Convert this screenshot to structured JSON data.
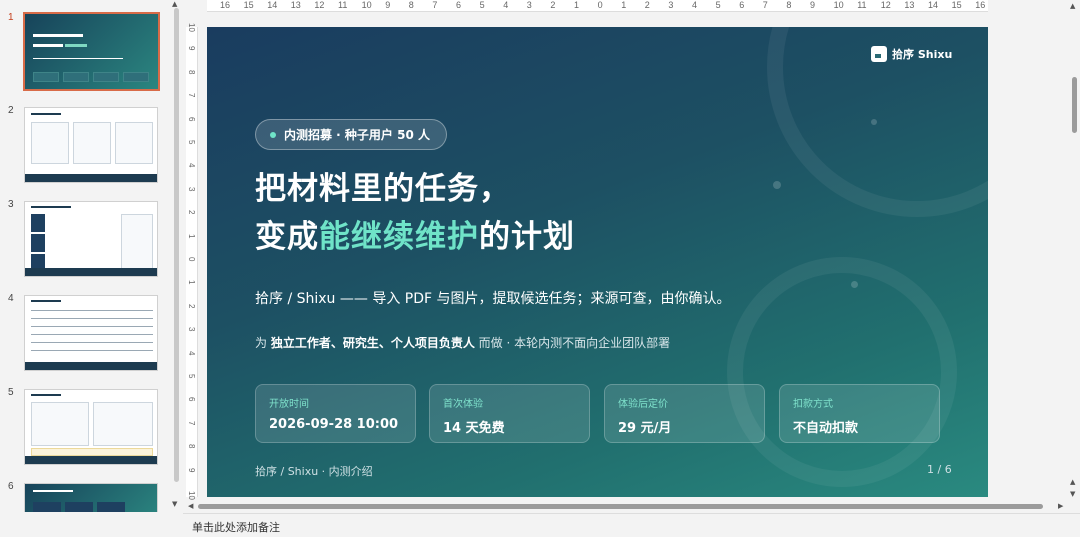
{
  "thumbnails": {
    "numbers": [
      "1",
      "2",
      "3",
      "4",
      "5",
      "6"
    ],
    "active_index": 1
  },
  "ruler": {
    "horizontal": [
      "16",
      "15",
      "14",
      "13",
      "12",
      "11",
      "10",
      "9",
      "8",
      "7",
      "6",
      "5",
      "4",
      "3",
      "2",
      "1",
      "0",
      "1",
      "2",
      "3",
      "4",
      "5",
      "6",
      "7",
      "8",
      "9",
      "10",
      "11",
      "12",
      "13",
      "14",
      "15",
      "16"
    ],
    "vertical": [
      "10",
      "9",
      "8",
      "7",
      "6",
      "5",
      "4",
      "3",
      "2",
      "1",
      "0",
      "1",
      "2",
      "3",
      "4",
      "5",
      "6",
      "7",
      "8",
      "9",
      "10"
    ]
  },
  "slide": {
    "brand": "拾序 Shixu",
    "pill": "内测招募 · 种子用户 50 人",
    "title_line1": "把材料里的任务，",
    "title_line2_prefix": "变成",
    "title_line2_highlight": "能继续维护",
    "title_line2_suffix": "的计划",
    "subtitle": "拾序 / Shixu —— 导入 PDF 与图片，提取候选任务；来源可查，由你确认。",
    "audience_prefix": "为 ",
    "audience_bold": "独立工作者、研究生、个人项目负责人",
    "audience_suffix": " 而做 · 本轮内测不面向企业团队部署",
    "cards": [
      {
        "label": "开放时间",
        "value": "2026-09-28 10:00"
      },
      {
        "label": "首次体验",
        "value": "14 天免费"
      },
      {
        "label": "体验后定价",
        "value": "29 元/月"
      },
      {
        "label": "扣款方式",
        "value": "不自动扣款"
      }
    ],
    "footer_left": "拾序 / Shixu · 内测介绍",
    "footer_right": "1 / 6",
    "colors": {
      "accent": "#6fe3c8",
      "bg_start": "#1a3c5f",
      "bg_end": "#2a8a80"
    }
  },
  "notes": {
    "placeholder": "单击此处添加备注"
  }
}
